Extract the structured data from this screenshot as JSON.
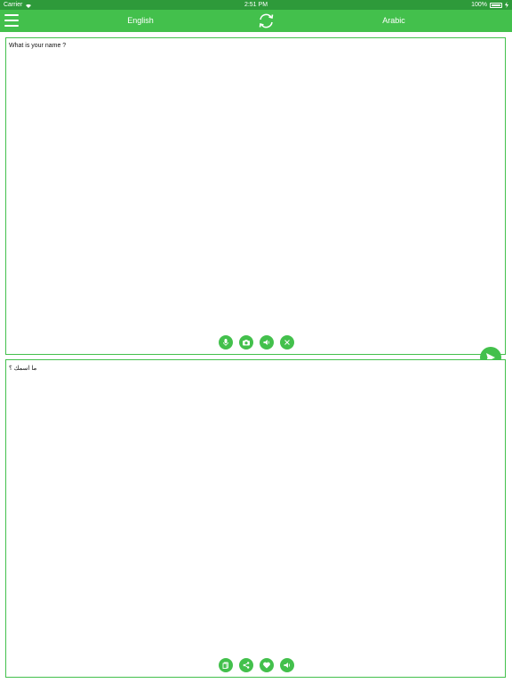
{
  "status_bar": {
    "carrier": "Carrier",
    "time": "2:51 PM",
    "battery": "100%",
    "color": "#2e9a3a"
  },
  "nav": {
    "source_language": "English",
    "target_language": "Arabic",
    "color": "#43c04c",
    "icons": [
      "menu-icon",
      "swap-languages-icon"
    ]
  },
  "input_panel": {
    "text": "What is your name ?",
    "tools": [
      "microphone-icon",
      "camera-icon",
      "speaker-icon",
      "clear-icon"
    ]
  },
  "send_button": {
    "icon": "send-icon"
  },
  "output_panel": {
    "text": "ما اسمك ؟",
    "tools": [
      "copy-icon",
      "share-icon",
      "favorite-icon",
      "speaker-icon"
    ]
  }
}
